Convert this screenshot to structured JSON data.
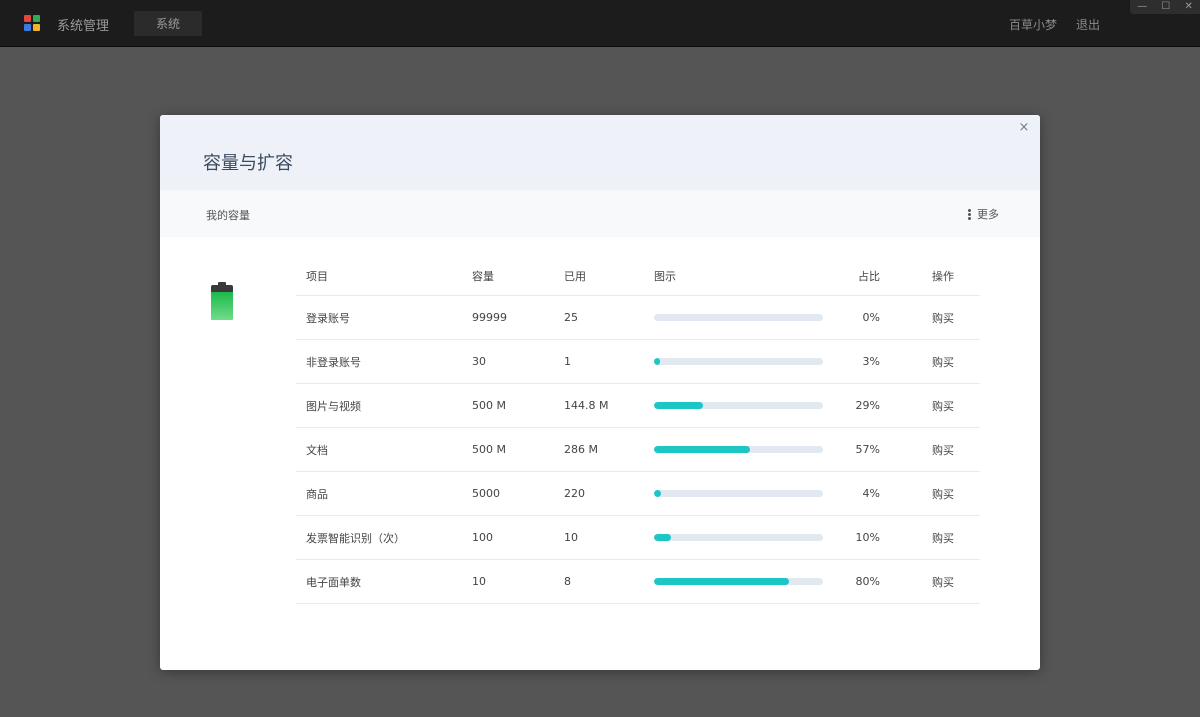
{
  "topbar": {
    "app_title": "系统管理",
    "tab_label": "系统",
    "user_name": "百草小梦",
    "logout_label": "退出",
    "window_controls": [
      "—",
      "☐",
      "✕"
    ],
    "logo_colors": [
      "#e2463c",
      "#2cae52",
      "#3b7be0",
      "#f0b42c"
    ]
  },
  "modal": {
    "title": "容量与扩容",
    "close_icon": "×",
    "section_title": "我的容量",
    "more_label": "更多",
    "battery_level": 0.8,
    "table": {
      "headers": [
        "项目",
        "容量",
        "已用",
        "图示",
        "占比",
        "操作"
      ],
      "rows": [
        {
          "name": "登录账号",
          "capacity": "99999",
          "used": "25",
          "ratio": 0.0,
          "percent": "0%",
          "action": "购买"
        },
        {
          "name": "非登录账号",
          "capacity": "30",
          "used": "1",
          "ratio": 0.03,
          "percent": "3%",
          "action": "购买"
        },
        {
          "name": "图片与视频",
          "capacity": "500 M",
          "used": "144.8 M",
          "ratio": 0.29,
          "percent": "29%",
          "action": "购买"
        },
        {
          "name": "文档",
          "capacity": "500 M",
          "used": "286 M",
          "ratio": 0.57,
          "percent": "57%",
          "action": "购买"
        },
        {
          "name": "商品",
          "capacity": "5000",
          "used": "220",
          "ratio": 0.04,
          "percent": "4%",
          "action": "购买"
        },
        {
          "name": "发票智能识别（次）",
          "capacity": "100",
          "used": "10",
          "ratio": 0.1,
          "percent": "10%",
          "action": "购买"
        },
        {
          "name": "电子面单数",
          "capacity": "10",
          "used": "8",
          "ratio": 0.8,
          "percent": "80%",
          "action": "购买"
        }
      ]
    },
    "colors": {
      "bar_fill": "#1cc6c4",
      "bar_track": "#e2e8f0",
      "header_bg": "#eef2f8"
    }
  }
}
